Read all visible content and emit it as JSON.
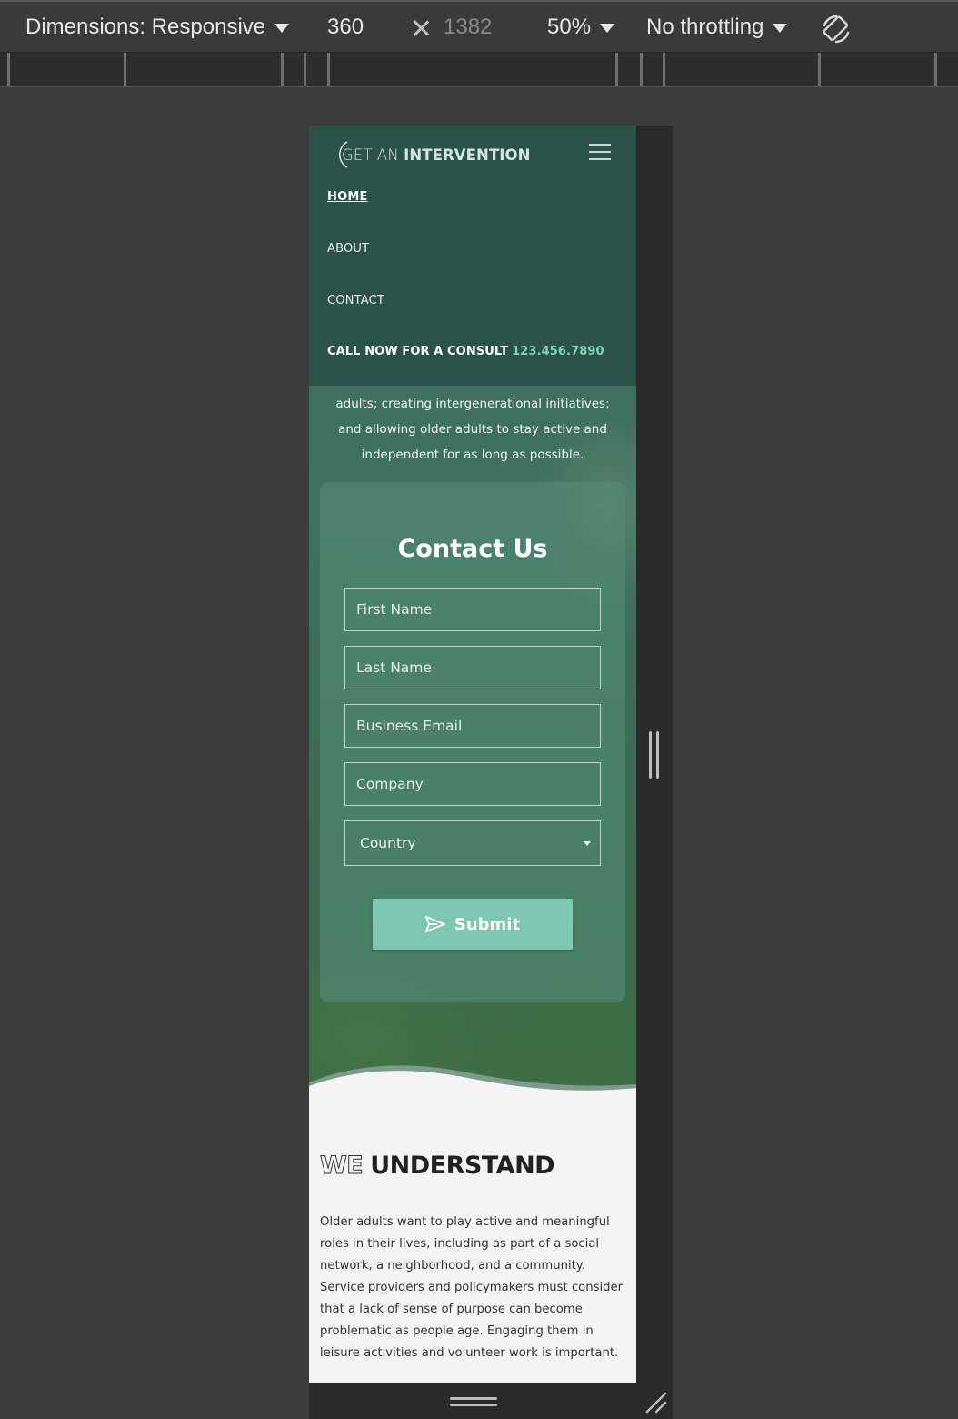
{
  "devtools": {
    "dimensions_label": "Dimensions: Responsive",
    "width": "360",
    "height": "1382",
    "zoom": "50%",
    "throttling": "No throttling"
  },
  "site": {
    "logo": {
      "light": "GET AN",
      "bold": "INTERVENTION"
    },
    "nav": {
      "home": "HOME",
      "about": "ABOUT",
      "contact": "CONTACT"
    },
    "consult": {
      "label": "CALL NOW FOR A CONSULT",
      "phone": "123.456.7890"
    },
    "intro_lines": [
      "adults; creating intergenerational initiatives;",
      "and allowing older adults to stay active and",
      "independent for as long as possible."
    ],
    "contact_form": {
      "title": "Contact Us",
      "first_name_placeholder": "First Name",
      "last_name_placeholder": "Last Name",
      "email_placeholder": "Business Email",
      "company_placeholder": "Company",
      "country_selected": "Country",
      "submit_label": "Submit"
    },
    "understand": {
      "title_outline": "WE",
      "title_solid": "UNDERSTAND",
      "body": "Older adults want to play active and meaningful roles in their lives, including as part of a social network, a neighborhood, and a community. Service providers and policymakers must consider that a lack of sense of purpose can become problematic as people age. Engaging them in leisure activities and volunteer work is important."
    },
    "colors": {
      "nav_bg": "#2b5248",
      "accent": "#7ec7b0",
      "phone": "#7ed6b4"
    }
  }
}
